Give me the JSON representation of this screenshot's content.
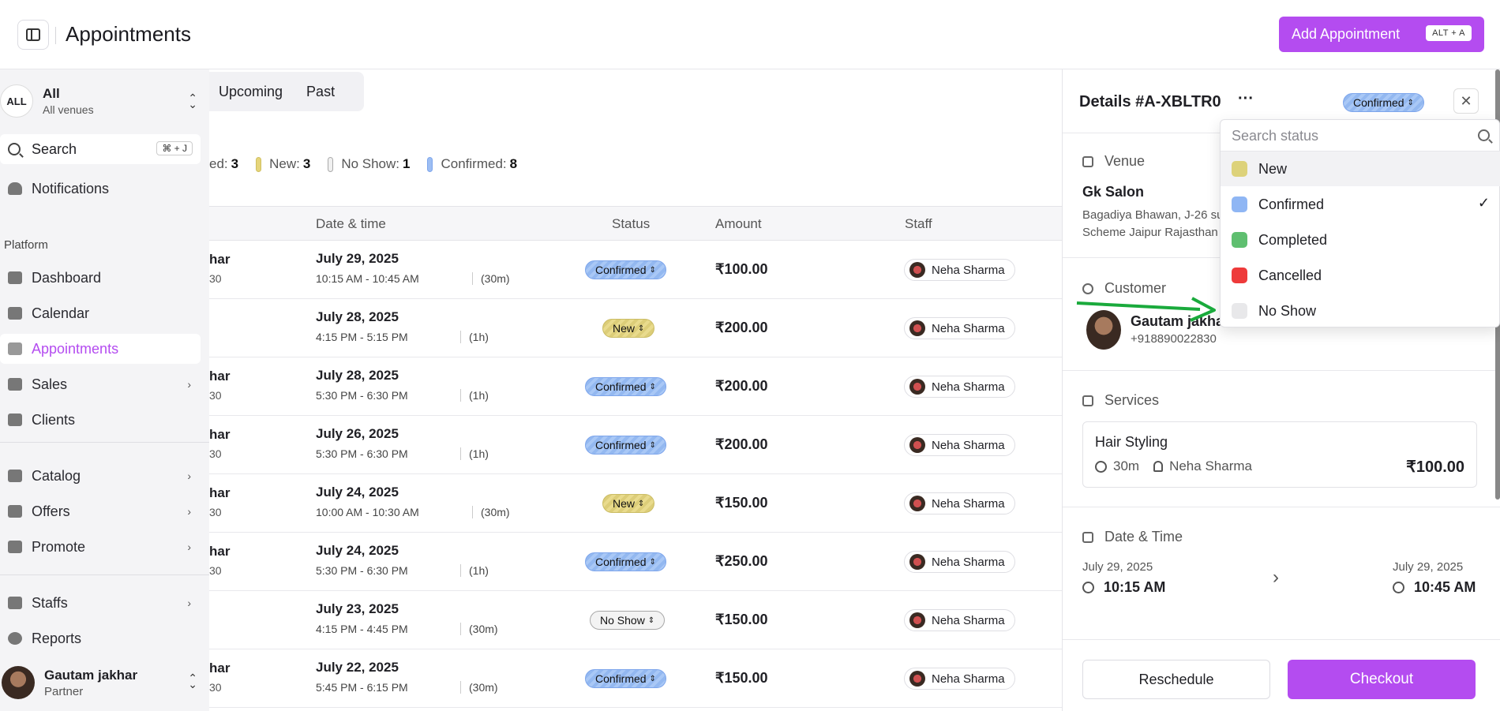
{
  "header": {
    "title": "Appointments",
    "add_button": "Add Appointment",
    "add_shortcut": "ALT + A"
  },
  "sidebar": {
    "venue": {
      "badge": "ALL",
      "name": "All",
      "sub": "All venues"
    },
    "search": {
      "label": "Search",
      "shortcut": "⌘ + J"
    },
    "notifications": "Notifications",
    "section_platform": "Platform",
    "items": [
      {
        "label": "Dashboard",
        "icon": "dashboard-icon"
      },
      {
        "label": "Calendar",
        "icon": "calendar-icon"
      },
      {
        "label": "Appointments",
        "icon": "list-icon",
        "active": true
      },
      {
        "label": "Sales",
        "icon": "money-icon",
        "chevron": true
      },
      {
        "label": "Clients",
        "icon": "users-icon"
      },
      {
        "label": "Catalog",
        "icon": "book-icon",
        "chevron": true
      },
      {
        "label": "Offers",
        "icon": "tag-icon",
        "chevron": true
      },
      {
        "label": "Promote",
        "icon": "megaphone-icon",
        "chevron": true
      },
      {
        "label": "Staffs",
        "icon": "staff-icon",
        "chevron": true
      },
      {
        "label": "Reports",
        "icon": "pie-icon"
      }
    ],
    "user": {
      "name": "Gautam jakhar",
      "role": "Partner"
    }
  },
  "tabs": [
    "Upcoming",
    "Past"
  ],
  "legend": [
    {
      "label": "ed:",
      "count": "3",
      "color": "#ffffff"
    },
    {
      "label": "New:",
      "count": "3",
      "color": "#e6d57a"
    },
    {
      "label": "No Show:",
      "count": "1",
      "color": "#e8e8e8"
    },
    {
      "label": "Confirmed:",
      "count": "8",
      "color": "#9dbef3"
    }
  ],
  "table": {
    "columns": [
      "Date & time",
      "Status",
      "Amount",
      "Staff"
    ],
    "rows": [
      {
        "cust": "har",
        "cust2": "30",
        "date": "July 29, 2025",
        "time": "10:15 AM - 10:45 AM",
        "dur": "(30m)",
        "status": "Confirmed",
        "amount": "₹100.00",
        "staff": "Neha Sharma"
      },
      {
        "cust": "",
        "cust2": "",
        "date": "July 28, 2025",
        "time": "4:15 PM - 5:15 PM",
        "dur": "(1h)",
        "status": "New",
        "amount": "₹200.00",
        "staff": "Neha Sharma"
      },
      {
        "cust": "har",
        "cust2": "30",
        "date": "July 28, 2025",
        "time": "5:30 PM - 6:30 PM",
        "dur": "(1h)",
        "status": "Confirmed",
        "amount": "₹200.00",
        "staff": "Neha Sharma"
      },
      {
        "cust": "har",
        "cust2": "30",
        "date": "July 26, 2025",
        "time": "5:30 PM - 6:30 PM",
        "dur": "(1h)",
        "status": "Confirmed",
        "amount": "₹200.00",
        "staff": "Neha Sharma"
      },
      {
        "cust": "har",
        "cust2": "30",
        "date": "July 24, 2025",
        "time": "10:00 AM - 10:30 AM",
        "dur": "(30m)",
        "status": "New",
        "amount": "₹150.00",
        "staff": "Neha Sharma"
      },
      {
        "cust": "har",
        "cust2": "30",
        "date": "July 24, 2025",
        "time": "5:30 PM - 6:30 PM",
        "dur": "(1h)",
        "status": "Confirmed",
        "amount": "₹250.00",
        "staff": "Neha Sharma"
      },
      {
        "cust": "",
        "cust2": "",
        "date": "July 23, 2025",
        "time": "4:15 PM - 4:45 PM",
        "dur": "(30m)",
        "status": "No Show",
        "amount": "₹150.00",
        "staff": "Neha Sharma"
      },
      {
        "cust": "har",
        "cust2": "30",
        "date": "July 22, 2025",
        "time": "5:45 PM - 6:15 PM",
        "dur": "(30m)",
        "status": "Confirmed",
        "amount": "₹150.00",
        "staff": "Neha Sharma"
      }
    ]
  },
  "details": {
    "title": "Details #A-XBLTR0",
    "dots": "···",
    "status": "Confirmed",
    "close": "✕",
    "venue_label": "Venue",
    "venue_name": "Gk Salon",
    "venue_addr1": "Bagadiya Bhawan, J-26 su",
    "venue_addr2": "Scheme Jaipur Rajasthan",
    "customer_label": "Customer",
    "customer_name": "Gautam jakhar",
    "customer_phone": "+918890022830",
    "services_label": "Services",
    "service_name": "Hair Styling",
    "service_duration": "30m",
    "service_staff": "Neha Sharma",
    "service_price": "₹100.00",
    "datetime_label": "Date & Time",
    "start_date": "July 29, 2025",
    "start_time": "10:15 AM",
    "end_date": "July 29, 2025",
    "end_time": "10:45 AM",
    "reschedule": "Reschedule",
    "checkout": "Checkout"
  },
  "status_dropdown": {
    "placeholder": "Search status",
    "options": [
      {
        "label": "New",
        "color": "#ddd27a"
      },
      {
        "label": "Confirmed",
        "color": "#8fb6f4",
        "selected": true
      },
      {
        "label": "Completed",
        "color": "#5fbf70"
      },
      {
        "label": "Cancelled",
        "color": "#ee3a3a"
      },
      {
        "label": "No Show",
        "color": "#e8e8ea"
      }
    ],
    "check": "✓"
  },
  "colors": {
    "accent": "#b44cf0"
  }
}
